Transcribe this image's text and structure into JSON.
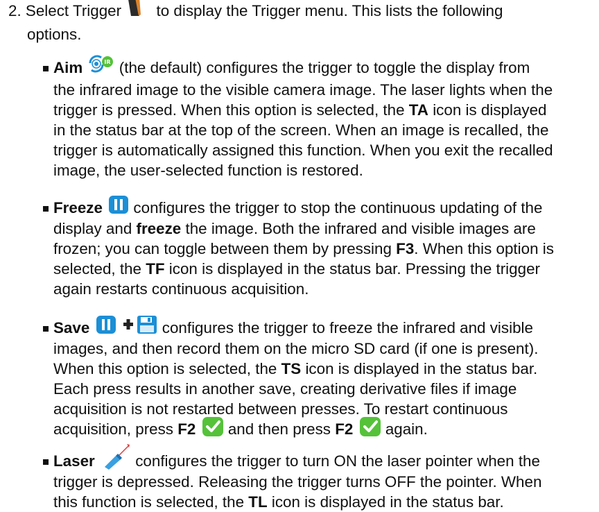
{
  "step": {
    "number": "2.",
    "line1_a": "Select Trigger",
    "line1_b": "to display the Trigger menu. This lists the following",
    "line2": "options."
  },
  "icons": {
    "trigger": "trigger-icon",
    "aim": "toggle-ir-visible-icon",
    "freeze": "pause-icon",
    "save_pause": "pause-icon",
    "save_plus": "plus-icon",
    "save_disk": "floppy-disk-icon",
    "check": "checkmark-icon",
    "laser": "laser-pointer-icon"
  },
  "colors": {
    "pause_blue": "#1c8fd6",
    "check_green": "#55c23a",
    "laser_red": "#e33b3b"
  },
  "aim": {
    "label": "Aim",
    "l1": "(the default) configures the trigger to toggle the display from",
    "l2": "the infrared image to the visible camera image. The laser lights when the",
    "l3": "trigger is pressed. When this option is selected, the",
    "l3_bold": "TA",
    "l3_b": "icon is displayed",
    "l4": "in the status bar at the top of the screen. When an image is recalled, the",
    "l5": "trigger is automatically assigned this function. When you exit the recalled",
    "l6": "image, the user-selected function is restored."
  },
  "freeze": {
    "label": "Freeze",
    "l1": "configures the trigger to stop the continuous updating of the",
    "l2_a": "display and",
    "l2_bold": "freeze",
    "l2_b": "the image. Both the infrared and visible images are",
    "l3_a": "frozen; you can toggle between them by pressing",
    "l3_bold": "F3",
    "l3_b": ". When this option is",
    "l4_a": "selected, the",
    "l4_bold": "TF",
    "l4_b": "icon is displayed in the status bar. Pressing the trigger",
    "l5": "again restarts continuous acquisition."
  },
  "save": {
    "label": "Save",
    "l1": "configures the trigger to freeze the infrared and visible",
    "l2": "images, and then record them on the micro SD card (if one is present).",
    "l3_a": "When this option is selected, the",
    "l3_bold": "TS",
    "l3_b": "icon is displayed in the status bar.",
    "l4": "Each press results in another save, creating derivative files if image",
    "l5": "acquisition is not restarted between presses. To restart continuous",
    "l6_a": "acquisition, press",
    "l6_bold1": "F2",
    "l6_b": "and then press",
    "l6_bold2": "F2",
    "l6_c": "again."
  },
  "laser": {
    "label": "Laser",
    "l1": "configures the trigger to turn ON the laser pointer when the",
    "l2": "trigger is depressed. Releasing the trigger turns OFF the pointer. When",
    "l3_a": "this function is selected, the",
    "l3_bold": "TL",
    "l3_b": "icon is displayed in the status bar."
  }
}
